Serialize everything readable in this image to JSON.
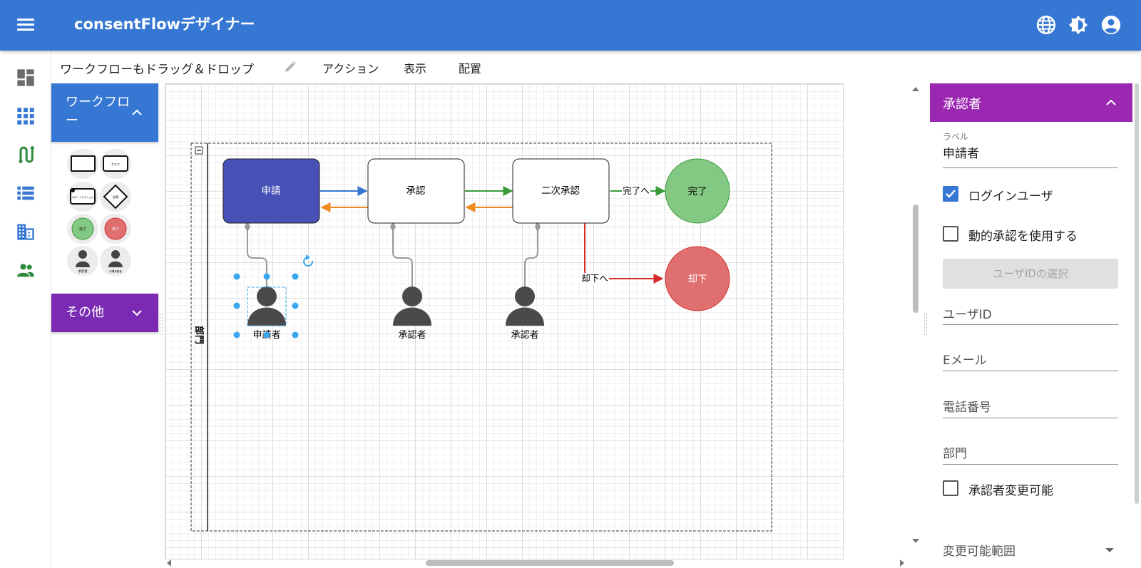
{
  "app": {
    "title": "consentFlowデザイナー"
  },
  "toolbar": {
    "workflow_name": "ワークフローもドラッグ＆ドロップ",
    "menus": [
      "アクション",
      "表示",
      "配置"
    ]
  },
  "palette": {
    "workflow_header": "ワークフロー",
    "other_header": "その他",
    "shapes": [
      {
        "kind": "task",
        "label": ""
      },
      {
        "kind": "task",
        "label": "タスク"
      },
      {
        "kind": "start",
        "label": "スタートアクション"
      },
      {
        "kind": "decision",
        "label": "分岐"
      },
      {
        "kind": "done",
        "label": "完了"
      },
      {
        "kind": "reject",
        "label": "却下"
      },
      {
        "kind": "approver",
        "label": "承認者"
      },
      {
        "kind": "approver",
        "label": "代理承認者"
      }
    ]
  },
  "diagram": {
    "lane_label": "部門",
    "nodes": {
      "apply": "申請",
      "approve": "承認",
      "second": "二次承認",
      "done": "完了",
      "reject": "却下"
    },
    "edge_labels": {
      "to_done": "完了へ",
      "to_reject": "却下へ"
    },
    "actors": [
      "申請者",
      "承認者",
      "承認者"
    ],
    "colors": {
      "apply_fill": "#4650b5",
      "done_fill": "#83c883",
      "reject_fill": "#e07070",
      "edge_blue": "#3677d4",
      "edge_orange": "#f08a1e",
      "edge_green": "#3a9a3a",
      "edge_red": "#d62b2b",
      "selection": "#3aa7f0"
    }
  },
  "panel": {
    "header": "承認者",
    "label_field": {
      "label": "ラベル",
      "value": "申請者"
    },
    "login_user": {
      "label": "ログインユーザ",
      "checked": true
    },
    "dynamic_approval": {
      "label": "動的承認を使用する",
      "checked": false
    },
    "select_user_button": "ユーザIDの選択",
    "user_id_placeholder": "ユーザID",
    "email_placeholder": "Eメール",
    "phone_placeholder": "電話番号",
    "dept_placeholder": "部門",
    "changeable": {
      "label": "承認者変更可能",
      "checked": false
    },
    "range_placeholder": "変更可能範囲"
  }
}
